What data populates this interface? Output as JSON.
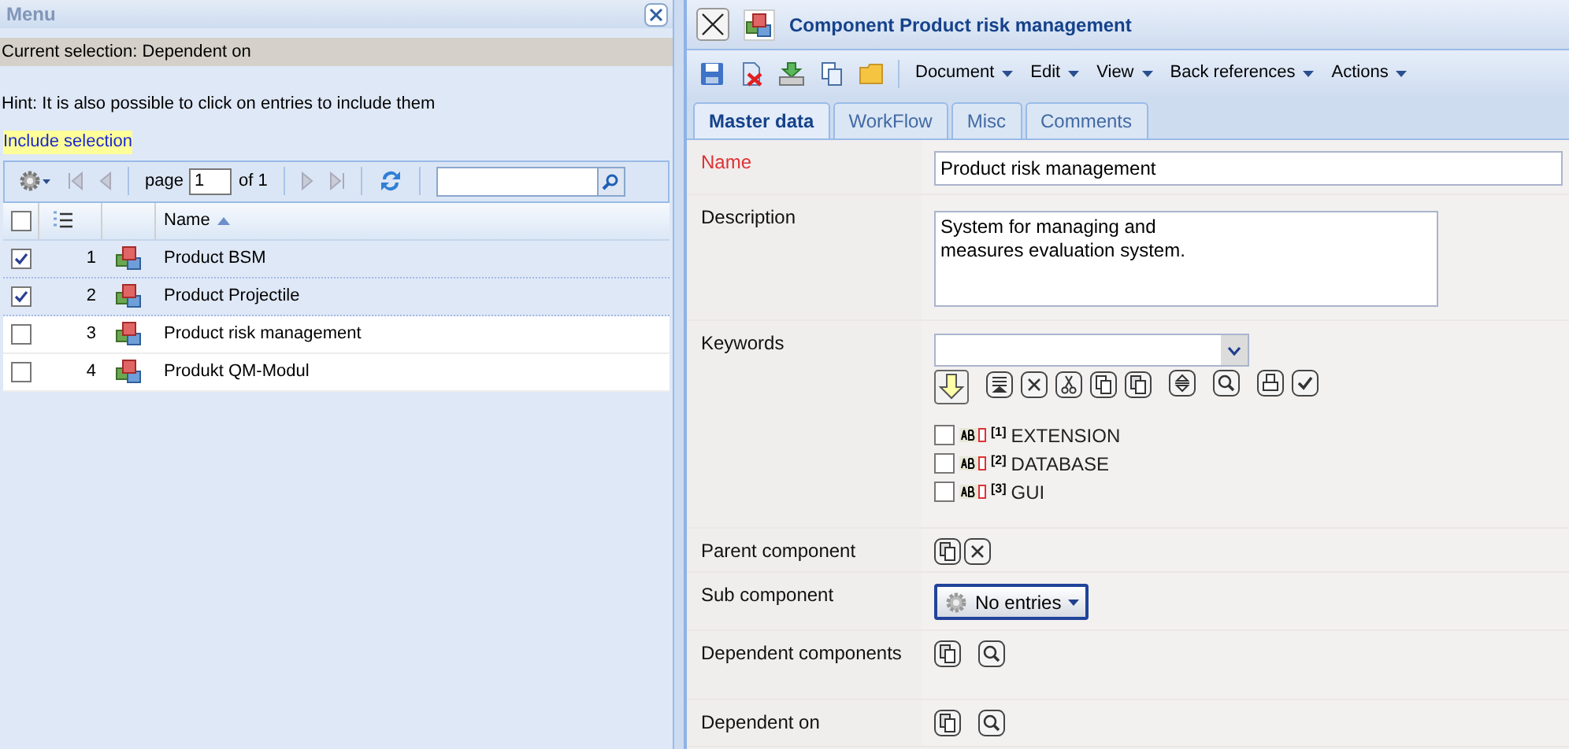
{
  "menu_panel": {
    "title": "Menu",
    "current_selection": "Current selection: Dependent on",
    "hint": "Hint: It is also possible to click on entries to include them",
    "include_link": "Include selection",
    "pager": {
      "page_label": "page",
      "page_value": "1",
      "of_label": "of 1"
    },
    "grid": {
      "columns": [
        "Name"
      ],
      "all_checked": false,
      "rows": [
        {
          "number": "1",
          "name": "Product BSM",
          "checked": true
        },
        {
          "number": "2",
          "name": "Product Projectile",
          "checked": true
        },
        {
          "number": "3",
          "name": "Product risk management",
          "checked": false
        },
        {
          "number": "4",
          "name": "Produkt QM-Modul",
          "checked": false
        }
      ]
    }
  },
  "editor": {
    "title": "Component Product risk management",
    "menus": [
      "Document",
      "Edit",
      "View",
      "Back references",
      "Actions"
    ],
    "tabs": [
      {
        "label": "Master data",
        "selected": true
      },
      {
        "label": "WorkFlow",
        "selected": false
      },
      {
        "label": "Misc",
        "selected": false
      },
      {
        "label": "Comments",
        "selected": false
      }
    ],
    "fields": [
      {
        "kind": "text",
        "label": "Name",
        "required": true,
        "value": "Product risk management"
      },
      {
        "kind": "textarea",
        "label": "Description",
        "required": false,
        "value": "System for managing and\nmeasures evaluation system."
      },
      {
        "kind": "keywords",
        "label": "Keywords",
        "required": false,
        "items": [
          {
            "index": "[1]",
            "text": "EXTENSION",
            "checked": false
          },
          {
            "index": "[2]",
            "text": "DATABASE",
            "checked": false
          },
          {
            "index": "[3]",
            "text": "GUI",
            "checked": false
          }
        ]
      },
      {
        "kind": "refs",
        "label": "Parent component",
        "required": false,
        "removable": true
      },
      {
        "kind": "menu",
        "label": "Sub component",
        "required": false,
        "button": "No entries"
      },
      {
        "kind": "refs",
        "label": "Dependent components",
        "required": false,
        "removable": false
      },
      {
        "kind": "refs",
        "label": "Dependent on",
        "required": false,
        "removable": false
      }
    ]
  }
}
